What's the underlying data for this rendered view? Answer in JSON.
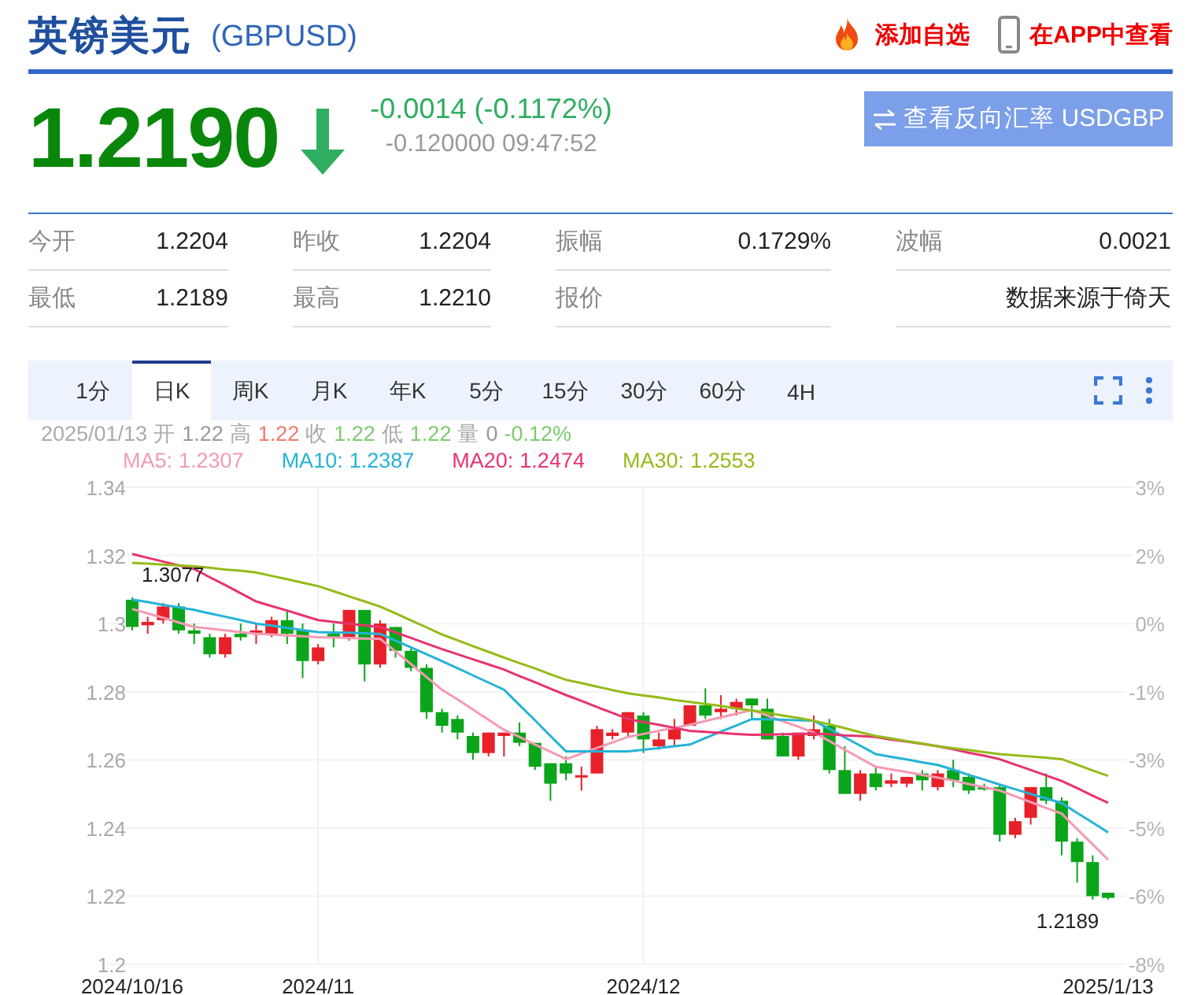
{
  "header": {
    "title": "英镑美元",
    "code": "(GBPUSD)",
    "actions": [
      {
        "kind": "favorite",
        "label": "添加自选"
      },
      {
        "kind": "app",
        "label": "在APP中查看"
      }
    ]
  },
  "quote": {
    "price": "1.2190",
    "falling": true,
    "change": "-0.0014 (-0.1172%)",
    "detail": "-0.120000 09:47:52",
    "reverse_button": "查看反向汇率 USDGBP"
  },
  "stats": [
    {
      "label": "今开",
      "value": "1.2204"
    },
    {
      "label": "昨收",
      "value": "1.2204"
    },
    {
      "label": "振幅",
      "value": "0.1729%"
    },
    {
      "label": "波幅",
      "value": "0.0021"
    },
    {
      "label": "最低",
      "value": "1.2189"
    },
    {
      "label": "最高",
      "value": "1.2210"
    },
    {
      "label": "报价"
    },
    {
      "value": "数据来源于倚天"
    }
  ],
  "tabs": [
    {
      "label": "1分",
      "selected": false
    },
    {
      "label": "日K",
      "selected": true
    },
    {
      "label": "周K",
      "selected": false
    },
    {
      "label": "月K",
      "selected": false
    },
    {
      "label": "年K",
      "selected": false
    },
    {
      "label": "5分",
      "selected": false
    },
    {
      "label": "15分",
      "selected": false
    },
    {
      "label": "30分",
      "selected": false
    },
    {
      "label": "60分",
      "selected": false
    },
    {
      "label": "4H",
      "selected": false
    }
  ],
  "info": {
    "date": "2025/01/13",
    "items": [
      {
        "label": "开",
        "value": "1.22",
        "color": "#999999"
      },
      {
        "label": "高",
        "value": "1.22",
        "color": "#f07a6e"
      },
      {
        "label": "收",
        "value": "1.22",
        "color": "#7ccb6e"
      },
      {
        "label": "低",
        "value": "1.22",
        "color": "#7ccb6e"
      },
      {
        "label": "量",
        "value": "0",
        "color": "#999999"
      }
    ],
    "change": "-0.12%"
  },
  "chart": {
    "ma_values": [
      "1.2307",
      "1.2387",
      "1.2474",
      "1.2553"
    ],
    "percent_axis": [
      "3%",
      "2%",
      "0%",
      "-1%",
      "-3%",
      "-5%",
      "-6%",
      "-8%"
    ],
    "chart_data": {
      "type": "candlestick",
      "grid": true,
      "categories": [
        "2024/10/16",
        null,
        null,
        null,
        null,
        null,
        null,
        null,
        null,
        null,
        null,
        null,
        "2024/11",
        null,
        null,
        null,
        null,
        null,
        null,
        null,
        null,
        null,
        null,
        null,
        null,
        null,
        null,
        null,
        null,
        null,
        null,
        null,
        null,
        "2024/12",
        null,
        null,
        null,
        null,
        null,
        null,
        null,
        null,
        null,
        null,
        null,
        null,
        null,
        null,
        null,
        null,
        null,
        null,
        null,
        null,
        null,
        null,
        null,
        null,
        null,
        null,
        null,
        null,
        null,
        "2025/1/13"
      ],
      "ylim": [
        1.2,
        1.34
      ],
      "yticks": [
        1.34,
        1.32,
        {
          "value": 1.3,
          "label": "1.3"
        },
        1.28,
        1.26,
        1.24,
        1.22,
        {
          "value": 1.2,
          "label": "1.2"
        }
      ],
      "ohlc": [
        [
          1.307,
          1.3077,
          1.298,
          1.299
        ],
        [
          1.2995,
          1.302,
          1.297,
          1.3005
        ],
        [
          1.301,
          1.306,
          1.3,
          1.305
        ],
        [
          1.305,
          1.306,
          1.297,
          1.298
        ],
        [
          1.298,
          1.3,
          1.294,
          1.297
        ],
        [
          1.296,
          1.297,
          1.29,
          1.291
        ],
        [
          1.291,
          1.297,
          1.29,
          1.296
        ],
        [
          1.297,
          1.3,
          1.295,
          1.296
        ],
        [
          1.2975,
          1.3,
          1.294,
          1.298
        ],
        [
          1.297,
          1.302,
          1.296,
          1.301
        ],
        [
          1.301,
          1.304,
          1.294,
          1.297
        ],
        [
          1.298,
          1.3,
          1.284,
          1.289
        ],
        [
          1.289,
          1.294,
          1.288,
          1.293
        ],
        [
          1.297,
          1.3,
          1.293,
          1.296
        ],
        [
          1.296,
          1.304,
          1.295,
          1.304
        ],
        [
          1.304,
          1.304,
          1.283,
          1.288
        ],
        [
          1.288,
          1.301,
          1.287,
          1.3
        ],
        [
          1.299,
          1.299,
          1.29,
          1.292
        ],
        [
          1.292,
          1.293,
          1.286,
          1.287
        ],
        [
          1.287,
          1.288,
          1.272,
          1.274
        ],
        [
          1.274,
          1.275,
          1.268,
          1.27
        ],
        [
          1.272,
          1.273,
          1.266,
          1.268
        ],
        [
          1.267,
          1.268,
          1.26,
          1.262
        ],
        [
          1.262,
          1.268,
          1.261,
          1.268
        ],
        [
          1.267,
          1.268,
          1.261,
          1.268
        ],
        [
          1.268,
          1.271,
          1.264,
          1.265
        ],
        [
          1.265,
          1.265,
          1.257,
          1.258
        ],
        [
          1.259,
          1.259,
          1.248,
          1.253
        ],
        [
          1.259,
          1.261,
          1.254,
          1.256
        ],
        [
          1.255,
          1.258,
          1.251,
          1.2555
        ],
        [
          1.256,
          1.27,
          1.256,
          1.269
        ],
        [
          1.267,
          1.269,
          1.266,
          1.268
        ],
        [
          1.268,
          1.274,
          1.267,
          1.274
        ],
        [
          1.273,
          1.274,
          1.262,
          1.266
        ],
        [
          1.264,
          1.268,
          1.263,
          1.266
        ],
        [
          1.266,
          1.272,
          1.264,
          1.269
        ],
        [
          1.27,
          1.276,
          1.27,
          1.276
        ],
        [
          1.276,
          1.281,
          1.272,
          1.273
        ],
        [
          1.274,
          1.279,
          1.272,
          1.275
        ],
        [
          1.275,
          1.278,
          1.273,
          1.277
        ],
        [
          1.278,
          1.278,
          1.272,
          1.276
        ],
        [
          1.275,
          1.278,
          1.266,
          1.266
        ],
        [
          1.267,
          1.268,
          1.261,
          1.261
        ],
        [
          1.261,
          1.268,
          1.26,
          1.268
        ],
        [
          1.267,
          1.273,
          1.266,
          1.269
        ],
        [
          1.27,
          1.272,
          1.256,
          1.257
        ],
        [
          1.257,
          1.264,
          1.25,
          1.25
        ],
        [
          1.25,
          1.257,
          1.248,
          1.256
        ],
        [
          1.256,
          1.258,
          1.251,
          1.252
        ],
        [
          1.253,
          1.256,
          1.252,
          1.254
        ],
        [
          1.253,
          1.255,
          1.252,
          1.255
        ],
        [
          1.256,
          1.257,
          1.251,
          1.254
        ],
        [
          1.252,
          1.257,
          1.251,
          1.256
        ],
        [
          1.257,
          1.26,
          1.252,
          1.254
        ],
        [
          1.255,
          1.256,
          1.25,
          1.251
        ],
        [
          1.252,
          1.253,
          1.251,
          1.2515
        ],
        [
          1.252,
          1.253,
          1.236,
          1.238
        ],
        [
          1.238,
          1.243,
          1.237,
          1.242
        ],
        [
          1.243,
          1.252,
          1.241,
          1.252
        ],
        [
          1.252,
          1.256,
          1.247,
          1.248
        ],
        [
          1.248,
          1.249,
          1.232,
          1.236
        ],
        [
          1.236,
          1.237,
          1.224,
          1.23
        ],
        [
          1.23,
          1.232,
          1.219,
          1.22
        ],
        [
          1.221,
          1.221,
          1.219,
          1.2195
        ]
      ],
      "series": [
        {
          "name": "MA5:",
          "type": "line",
          "color": "#f59ab3",
          "values": [
            1.3043,
            1.303,
            1.3017,
            1.3003,
            1.299,
            1.2985,
            1.298,
            1.2975,
            1.297,
            1.2968,
            1.2965,
            1.2963,
            1.296,
            1.2959,
            1.2958,
            1.2956,
            1.2955,
            1.2918,
            1.2881,
            1.2843,
            1.2806,
            1.2777,
            1.2747,
            1.2718,
            1.2688,
            1.2667,
            1.2645,
            1.2624,
            1.2602,
            1.2618,
            1.2635,
            1.2651,
            1.2667,
            1.2676,
            1.2685,
            1.2694,
            1.2703,
            1.2714,
            1.2725,
            1.2735,
            1.2746,
            1.273,
            1.2713,
            1.2697,
            1.268,
            1.2655,
            1.263,
            1.2605,
            1.258,
            1.2572,
            1.2564,
            1.2556,
            1.2548,
            1.2539,
            1.2529,
            1.252,
            1.251,
            1.2493,
            1.2476,
            1.2459,
            1.2442,
            1.2397,
            1.2352,
            1.2307
          ]
        },
        {
          "name": "MA10:",
          "type": "line",
          "color": "#24b3d6",
          "values": [
            1.307,
            1.3063,
            1.3055,
            1.3048,
            1.304,
            1.303,
            1.302,
            1.301,
            1.3,
            1.2994,
            1.2988,
            1.2981,
            1.2975,
            1.2974,
            1.2973,
            1.2971,
            1.297,
            1.295,
            1.293,
            1.291,
            1.289,
            1.2869,
            1.2848,
            1.2827,
            1.2806,
            1.2761,
            1.2716,
            1.267,
            1.2625,
            1.2625,
            1.2625,
            1.2625,
            1.2625,
            1.263,
            1.2635,
            1.264,
            1.2645,
            1.2664,
            1.2683,
            1.2701,
            1.272,
            1.2719,
            1.2718,
            1.2716,
            1.2715,
            1.2691,
            1.2666,
            1.2642,
            1.2617,
            1.2609,
            1.2601,
            1.2593,
            1.2585,
            1.2571,
            1.2556,
            1.2542,
            1.2527,
            1.2514,
            1.25,
            1.2487,
            1.2473,
            1.2444,
            1.2416,
            1.2387
          ]
        },
        {
          "name": "MA20:",
          "type": "line",
          "color": "#e8336e",
          "values": [
            1.3204,
            1.3193,
            1.3182,
            1.3171,
            1.316,
            1.3136,
            1.3113,
            1.3089,
            1.3065,
            1.3051,
            1.3038,
            1.3024,
            1.301,
            1.3005,
            1.3,
            1.2995,
            1.299,
            1.2974,
            1.2958,
            1.2941,
            1.2925,
            1.291,
            1.2895,
            1.288,
            1.2865,
            1.2846,
            1.2828,
            1.2809,
            1.279,
            1.2773,
            1.2755,
            1.2738,
            1.272,
            1.2711,
            1.2703,
            1.2694,
            1.2685,
            1.2682,
            1.2679,
            1.2676,
            1.2673,
            1.2674,
            1.2675,
            1.2676,
            1.2677,
            1.2675,
            1.2672,
            1.267,
            1.2667,
            1.266,
            1.2654,
            1.2647,
            1.264,
            1.2631,
            1.2621,
            1.2612,
            1.2602,
            1.2586,
            1.257,
            1.2554,
            1.2538,
            1.2517,
            1.2495,
            1.2474
          ]
        },
        {
          "name": "MA30:",
          "type": "line",
          "color": "#94bb18",
          "values": [
            1.3178,
            1.3176,
            1.3173,
            1.3171,
            1.3168,
            1.3164,
            1.3159,
            1.3155,
            1.315,
            1.314,
            1.313,
            1.312,
            1.311,
            1.3095,
            1.308,
            1.3065,
            1.305,
            1.303,
            1.3009,
            1.2989,
            1.2968,
            1.2951,
            1.2934,
            1.2917,
            1.29,
            1.2884,
            1.2868,
            1.2851,
            1.2835,
            1.2825,
            1.2815,
            1.2805,
            1.2795,
            1.2789,
            1.2783,
            1.2776,
            1.277,
            1.2764,
            1.2758,
            1.2751,
            1.2745,
            1.2738,
            1.273,
            1.2723,
            1.2715,
            1.2704,
            1.2693,
            1.2681,
            1.267,
            1.2663,
            1.2655,
            1.2648,
            1.264,
            1.2634,
            1.2629,
            1.2623,
            1.2617,
            1.2613,
            1.261,
            1.2606,
            1.2602,
            1.2586,
            1.2569,
            1.2553
          ]
        }
      ],
      "annotations": [
        "1.3077",
        "1.2189"
      ]
    }
  }
}
